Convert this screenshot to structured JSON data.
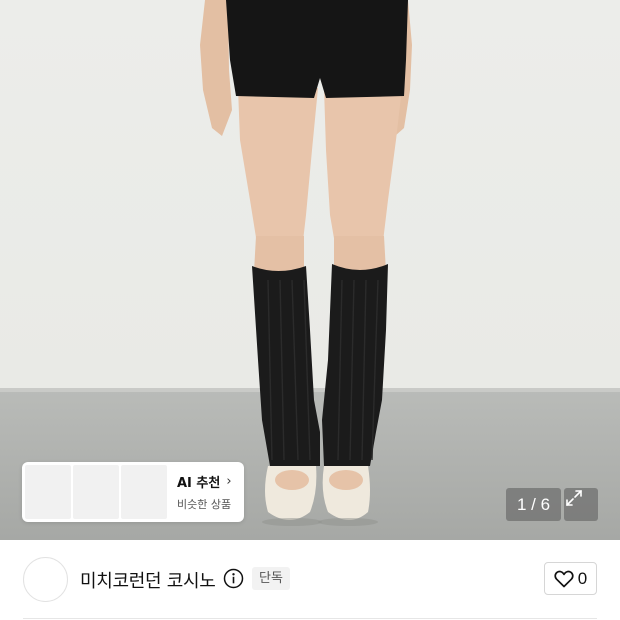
{
  "product_image": {
    "counter": "1 / 6"
  },
  "ai_recommend": {
    "title": "AI 추천",
    "chevron": "›",
    "subtitle": "비슷한 상품",
    "thumbnail_count": 3
  },
  "store": {
    "name": "미치코런던 코시노",
    "badge": "단독",
    "like_count": "0"
  },
  "icons": {
    "expand": "expand-icon",
    "info": "info-icon",
    "heart": "heart-icon",
    "chevron": "chevron-right-icon"
  },
  "colors": {
    "legwarmer": "#1a1a1a",
    "shorts": "#151515",
    "shoes": "#efe9dd",
    "skin": "#e6c3a8"
  }
}
